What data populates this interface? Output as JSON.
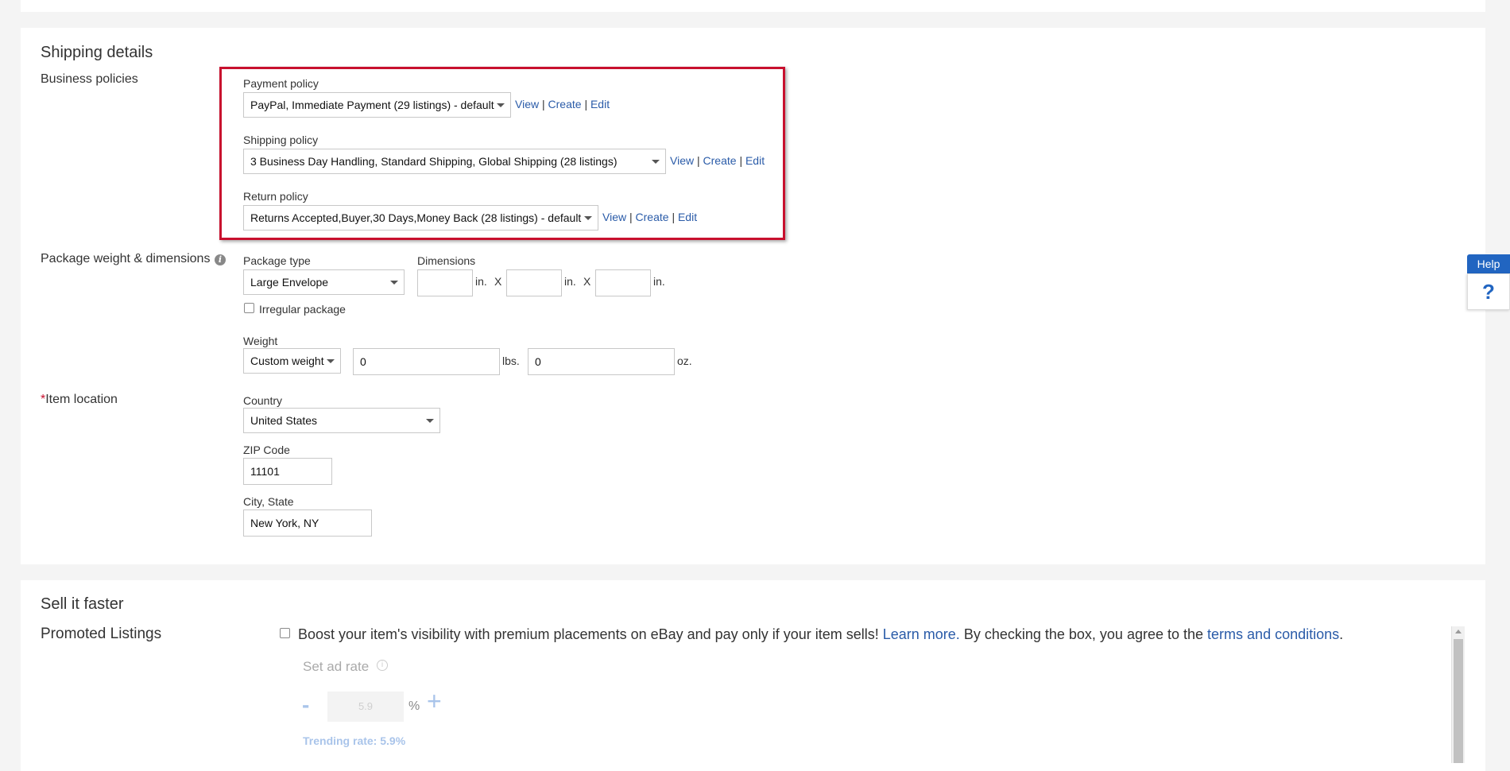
{
  "shipping": {
    "title": "Shipping details",
    "business_policies_label": "Business policies",
    "payment": {
      "label": "Payment policy",
      "value": "PayPal, Immediate Payment (29 listings) - default"
    },
    "shipping_policy": {
      "label": "Shipping policy",
      "value": "3 Business Day Handling, Standard Shipping, Global Shipping (28 listings)"
    },
    "return": {
      "label": "Return policy",
      "value": "Returns Accepted,Buyer,30 Days,Money Back (28 listings) - default"
    },
    "links": {
      "view": "View",
      "create": "Create",
      "edit": "Edit",
      "sep": "|"
    },
    "package": {
      "row_label": "Package weight & dimensions",
      "type_label": "Package type",
      "type_value": "Large Envelope",
      "dimensions_label": "Dimensions",
      "dim_unit": "in.",
      "dim_x": "X",
      "irregular_label": "Irregular package",
      "weight_label": "Weight",
      "weight_select": "Custom weight",
      "lbs_value": "0",
      "lbs_unit": "lbs.",
      "oz_value": "0",
      "oz_unit": "oz."
    },
    "location": {
      "required_mark": "*",
      "row_label": "Item location",
      "country_label": "Country",
      "country_value": "United States",
      "zip_label": "ZIP Code",
      "zip_value": "11101",
      "city_label": "City, State",
      "city_value": "New York, NY"
    }
  },
  "sell": {
    "title": "Sell it faster",
    "promoted_label": "Promoted Listings",
    "boost_text": "Boost your item's visibility with premium placements on eBay and pay only if your item sells!",
    "learn_more": "Learn more.",
    "agree_text": "By checking the box, you agree to the",
    "terms": "terms and conditions",
    "period": ".",
    "ad_rate_label": "Set ad rate",
    "minus": "-",
    "rate_placeholder": "5.9",
    "percent": "%",
    "plus": "+",
    "trending": "Trending rate: 5.9%"
  },
  "help": {
    "label": "Help",
    "q": "?"
  },
  "colors": {
    "link": "#2a5ba8",
    "highlight": "#c8102e",
    "help": "#2165c1"
  }
}
